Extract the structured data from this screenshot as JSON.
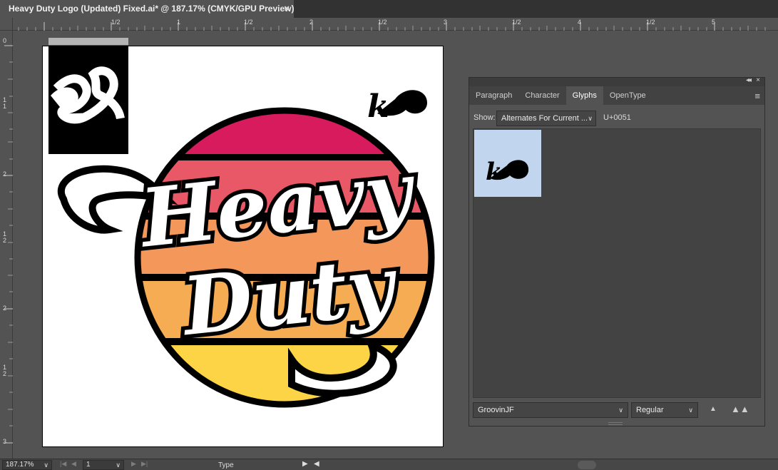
{
  "document": {
    "tab_title": "Heavy Duty Logo (Updated) Fixed.ai* @ 187.17% (CMYK/GPU Preview)",
    "close_glyph": "×"
  },
  "rulers": {
    "horizontal": [
      "1/2",
      "1",
      "1/2",
      "2",
      "1/2",
      "3",
      "1/2",
      "4",
      "1/2",
      "5"
    ],
    "vertical": [
      "0",
      "1",
      "1",
      "2",
      "1",
      "2",
      "2",
      "1",
      "2",
      "3"
    ],
    "start": "0"
  },
  "artwork": {
    "word_top": "Heavy",
    "word_bottom": "Duty",
    "glyph_char": "k",
    "colors": {
      "stripe1": "#d81b5c",
      "stripe2": "#e95866",
      "stripe3": "#f4975a",
      "stripe4": "#f6ac52",
      "stripe5": "#fdd445",
      "outline": "#000000",
      "letter_fill": "#ffffff"
    }
  },
  "glyphs_panel": {
    "tabs": [
      "Paragraph",
      "Character",
      "Glyphs",
      "OpenType"
    ],
    "active_tab": "Glyphs",
    "show_label": "Show:",
    "show_value": "Alternates For Current ...",
    "unicode": "U+0051",
    "font_family": "GroovinJF",
    "font_style": "Regular"
  },
  "status_bar": {
    "zoom": "187.17%",
    "artboard_number": "1",
    "mode": "Type"
  }
}
